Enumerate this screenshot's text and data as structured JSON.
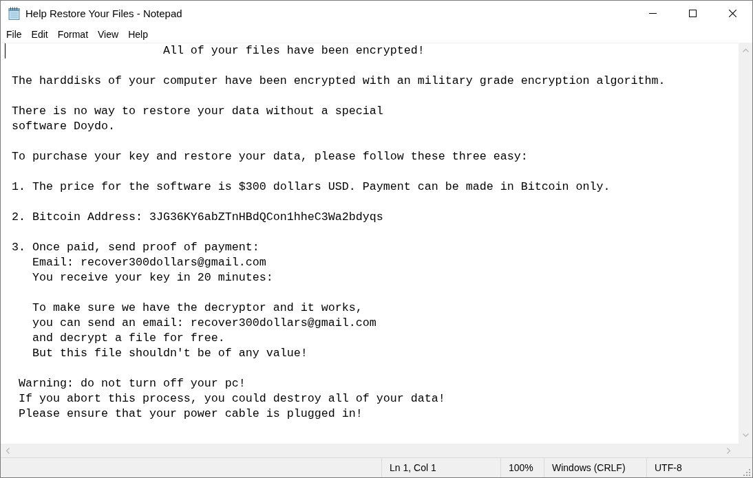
{
  "window": {
    "title": "Help Restore Your Files - Notepad"
  },
  "menu": [
    "File",
    "Edit",
    "Format",
    "View",
    "Help"
  ],
  "document": {
    "paragraphs": [
      [
        "                       All of your files have been encrypted!"
      ],
      [
        " The harddisks of your computer have been encrypted with an military grade encryption algorithm."
      ],
      [
        " There is no way to restore your data without a special",
        " software Doydo."
      ],
      [
        " To purchase your key and restore your data, please follow these three easy:"
      ],
      [
        " 1. The price for the software is $300 dollars USD. Payment can be made in Bitcoin only."
      ],
      [
        " 2. Bitcoin Address: 3JG36KY6abZTnHBdQCon1hheC3Wa2bdyqs"
      ],
      [
        " 3. Once paid, send proof of payment:",
        "    Email: recover300dollars@gmail.com",
        "    You receive your key in 20 minutes:"
      ],
      [
        "    To make sure we have the decryptor and it works,",
        "    you can send an email: recover300dollars@gmail.com",
        "    and decrypt a file for free.",
        "    But this file shouldn't be of any value!"
      ],
      [
        "  Warning: do not turn off your pc!",
        "  If you abort this process, you could destroy all of your data!",
        "  Please ensure that your power cable is plugged in!"
      ]
    ]
  },
  "status_bar": {
    "position": "Ln 1, Col 1",
    "zoom": "100%",
    "line_ending": "Windows (CRLF)",
    "encoding": "UTF-8"
  }
}
